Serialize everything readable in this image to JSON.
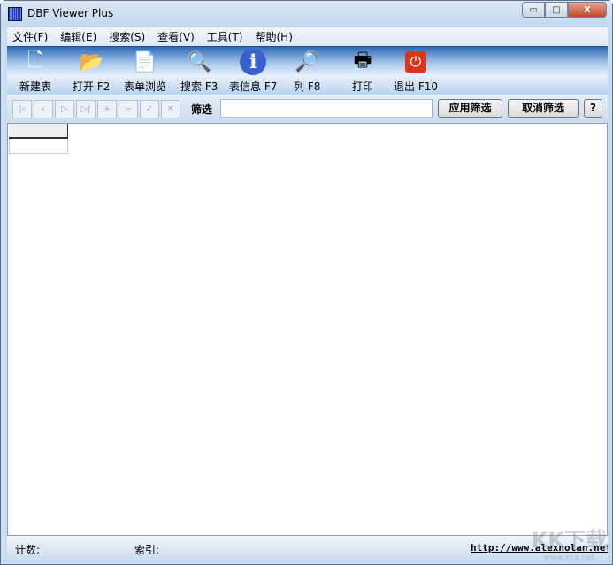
{
  "window": {
    "title": "DBF Viewer Plus",
    "minimize": "▭",
    "maximize": "□",
    "close": "X"
  },
  "menu": [
    "文件(F)",
    "编辑(E)",
    "搜索(S)",
    "查看(V)",
    "工具(T)",
    "帮助(H)"
  ],
  "toolbar": [
    {
      "label": "新建表",
      "icon": "new-table-icon",
      "glyph": "🗋"
    },
    {
      "label": "打开 F2",
      "icon": "folder-open-icon",
      "glyph": "📂"
    },
    {
      "label": "表单浏览",
      "icon": "form-browse-icon",
      "glyph": "📄"
    },
    {
      "label": "搜索 F3",
      "icon": "search-icon",
      "glyph": "🔍"
    },
    {
      "label": "表信息 F7",
      "icon": "info-icon",
      "glyph": "ℹ"
    },
    {
      "label": "列 F8",
      "icon": "columns-icon",
      "glyph": "🔎"
    },
    {
      "label": "打印",
      "icon": "printer-icon",
      "glyph": "🖶"
    },
    {
      "label": "退出 F10",
      "icon": "exit-icon",
      "glyph": "⏻"
    }
  ],
  "nav_buttons": [
    "|‹",
    "‹",
    "▷",
    "▷|",
    "+",
    "−",
    "✓",
    "✕"
  ],
  "filter": {
    "label": "筛选",
    "value": "",
    "apply": "应用筛选",
    "cancel": "取消筛选",
    "help": "?"
  },
  "status": {
    "count_label": "计数:",
    "index_label": "索引:",
    "link": "http://www.alexnolan.net"
  },
  "watermark": {
    "logo": "KK下载",
    "url": "www.kkx.net"
  }
}
